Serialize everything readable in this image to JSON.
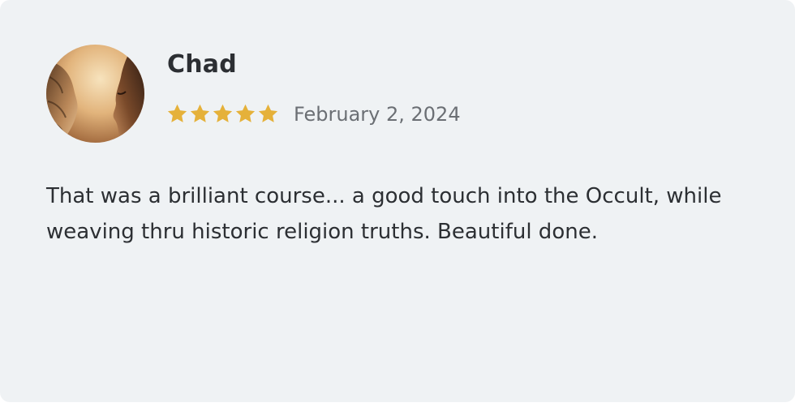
{
  "review": {
    "reviewer_name": "Chad",
    "rating": 5,
    "rating_max": 5,
    "date": "February 2, 2024",
    "text": "That was a brilliant course... a good touch into the Occult, while weaving thru historic religion truths. Beautiful done."
  },
  "icons": {
    "star": "star-icon"
  },
  "colors": {
    "card_background": "#eff2f4",
    "star": "#e5b13a",
    "name_text": "#2c2f33",
    "date_text": "#6b6f74"
  }
}
